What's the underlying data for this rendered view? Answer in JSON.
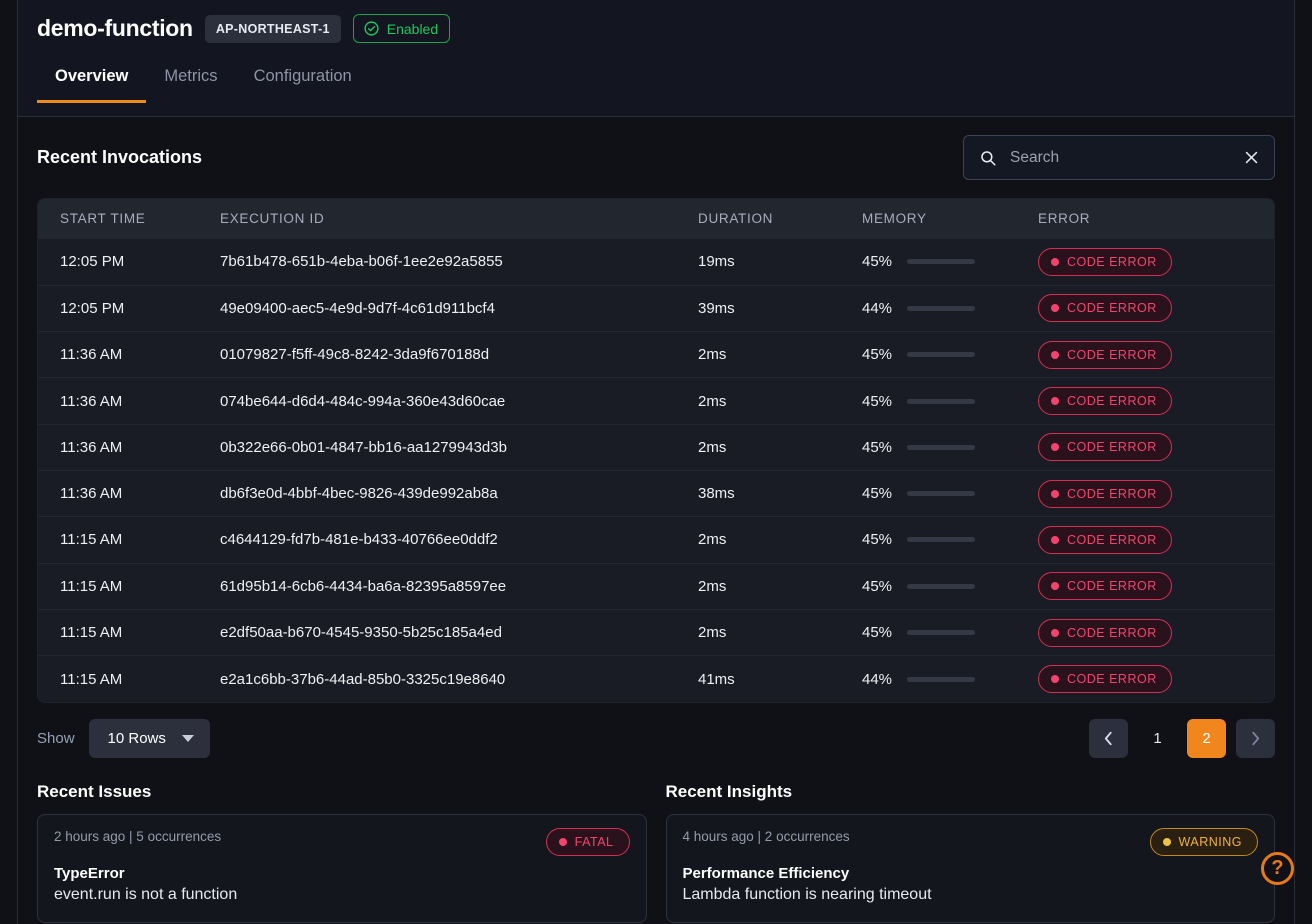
{
  "header": {
    "function_name": "demo-function",
    "region_badge": "AP-NORTHEAST-1",
    "status_badge": "Enabled",
    "status_color": "#22c55e",
    "accent_color": "#f08a1d",
    "tabs": [
      {
        "label": "Overview",
        "active": true
      },
      {
        "label": "Metrics",
        "active": false
      },
      {
        "label": "Configuration",
        "active": false
      }
    ]
  },
  "invocations": {
    "title": "Recent Invocations",
    "search": {
      "placeholder": "Search",
      "value": ""
    },
    "columns": [
      "START TIME",
      "EXECUTION ID",
      "DURATION",
      "MEMORY",
      "ERROR"
    ],
    "rows": [
      {
        "start_time": "12:05 PM",
        "execution_id": "7b61b478-651b-4eba-b06f-1ee2e92a5855",
        "duration": "19ms",
        "memory": "45%",
        "memory_value": 45,
        "error": "CODE ERROR"
      },
      {
        "start_time": "12:05 PM",
        "execution_id": "49e09400-aec5-4e9d-9d7f-4c61d911bcf4",
        "duration": "39ms",
        "memory": "44%",
        "memory_value": 44,
        "error": "CODE ERROR"
      },
      {
        "start_time": "11:36 AM",
        "execution_id": "01079827-f5ff-49c8-8242-3da9f670188d",
        "duration": "2ms",
        "memory": "45%",
        "memory_value": 45,
        "error": "CODE ERROR"
      },
      {
        "start_time": "11:36 AM",
        "execution_id": "074be644-d6d4-484c-994a-360e43d60cae",
        "duration": "2ms",
        "memory": "45%",
        "memory_value": 45,
        "error": "CODE ERROR"
      },
      {
        "start_time": "11:36 AM",
        "execution_id": "0b322e66-0b01-4847-bb16-aa1279943d3b",
        "duration": "2ms",
        "memory": "45%",
        "memory_value": 45,
        "error": "CODE ERROR"
      },
      {
        "start_time": "11:36 AM",
        "execution_id": "db6f3e0d-4bbf-4bec-9826-439de992ab8a",
        "duration": "38ms",
        "memory": "45%",
        "memory_value": 45,
        "error": "CODE ERROR"
      },
      {
        "start_time": "11:15 AM",
        "execution_id": "c4644129-fd7b-481e-b433-40766ee0ddf2",
        "duration": "2ms",
        "memory": "45%",
        "memory_value": 45,
        "error": "CODE ERROR"
      },
      {
        "start_time": "11:15 AM",
        "execution_id": "61d95b14-6cb6-4434-ba6a-82395a8597ee",
        "duration": "2ms",
        "memory": "45%",
        "memory_value": 45,
        "error": "CODE ERROR"
      },
      {
        "start_time": "11:15 AM",
        "execution_id": "e2df50aa-b670-4545-9350-5b25c185a4ed",
        "duration": "2ms",
        "memory": "45%",
        "memory_value": 45,
        "error": "CODE ERROR"
      },
      {
        "start_time": "11:15 AM",
        "execution_id": "e2a1c6bb-37b6-44ad-85b0-3325c19e8640",
        "duration": "41ms",
        "memory": "44%",
        "memory_value": 44,
        "error": "CODE ERROR"
      }
    ]
  },
  "controls": {
    "show_label": "Show",
    "rows_per_page": "10 Rows",
    "pagination": {
      "prev": "‹",
      "next": "›",
      "pages": [
        "1",
        "2"
      ],
      "current": "2"
    }
  },
  "issues": {
    "title": "Recent Issues",
    "card": {
      "meta": "2 hours ago | 5 occurrences",
      "severity": "FATAL",
      "name": "TypeError",
      "description": "event.run is not a function"
    }
  },
  "insights": {
    "title": "Recent Insights",
    "card": {
      "meta": "4 hours ago | 2 occurrences",
      "severity": "WARNING",
      "name": "Performance Efficiency",
      "description": "Lambda function is nearing timeout"
    }
  },
  "help": {
    "label": "?"
  }
}
